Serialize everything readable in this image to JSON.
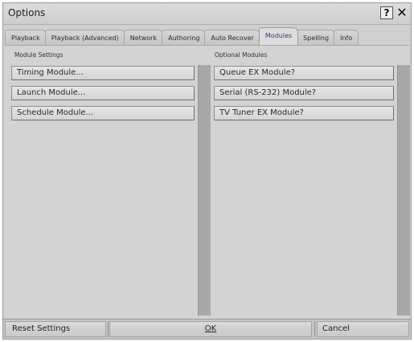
{
  "window": {
    "title": "Options"
  },
  "titlebar": {
    "help_label": "?",
    "close_label": "✕"
  },
  "tabs": [
    {
      "label": "Playback",
      "active": false
    },
    {
      "label": "Playback (Advanced)",
      "active": false
    },
    {
      "label": "Network",
      "active": false
    },
    {
      "label": "Authoring",
      "active": false
    },
    {
      "label": "Auto Recover",
      "active": false
    },
    {
      "label": "Modules",
      "active": true
    },
    {
      "label": "Spelling",
      "active": false
    },
    {
      "label": "Info",
      "active": false
    }
  ],
  "module_settings": {
    "heading": "Module Settings",
    "buttons": [
      "Timing Module...",
      "Launch Module...",
      "Schedule Module..."
    ]
  },
  "optional_modules": {
    "heading": "Optional Modules",
    "buttons": [
      "Queue EX Module?",
      "Serial (RS-232) Module?",
      "TV Tuner EX Module?"
    ]
  },
  "footer": {
    "reset_label": "Reset Settings",
    "ok_label": "OK",
    "cancel_label": "Cancel"
  }
}
